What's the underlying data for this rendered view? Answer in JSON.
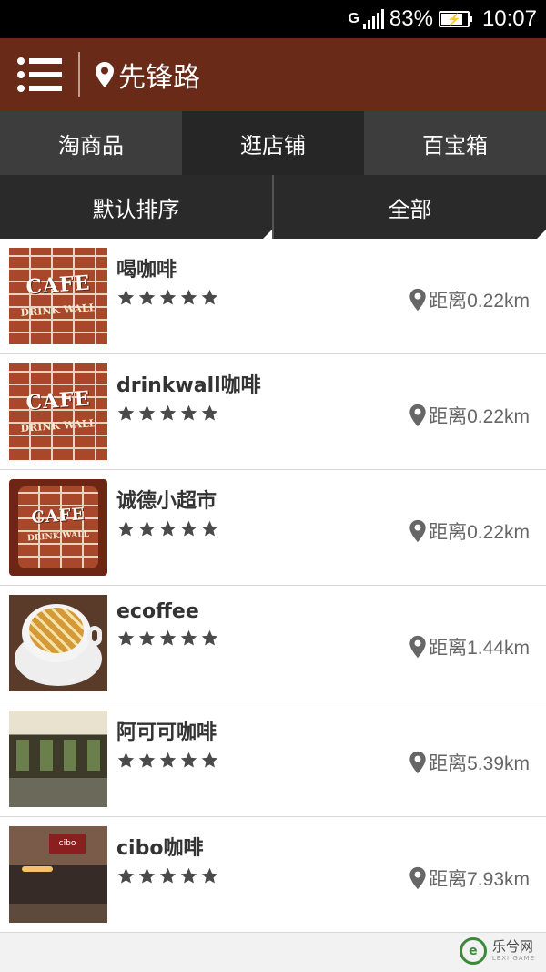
{
  "status_bar": {
    "network": "G",
    "battery": "83%",
    "battery_level": 0.83,
    "time": "10:07"
  },
  "header": {
    "location": "先锋路"
  },
  "tabs": [
    {
      "label": "淘商品"
    },
    {
      "label": "逛店铺"
    },
    {
      "label": "百宝箱"
    }
  ],
  "sort": {
    "order_label": "默认排序",
    "filter_label": "全部"
  },
  "shops": [
    {
      "name": "喝咖啡",
      "rating": 5,
      "distance": "距离0.22km",
      "thumb": "cafe-brick-wall",
      "thumb_title": "CAFE",
      "thumb_subtitle": "DRINK WALL"
    },
    {
      "name": "drinkwall咖啡",
      "rating": 5,
      "distance": "距离0.22km",
      "thumb": "cafe-brick-wall",
      "thumb_title": "CAFE",
      "thumb_subtitle": "DRINK WALL"
    },
    {
      "name": "诚德小超市",
      "rating": 5,
      "distance": "距离0.22km",
      "thumb": "cafe-brick-wall-rounded",
      "thumb_title": "CAFE",
      "thumb_subtitle": "DRINK WALL"
    },
    {
      "name": "ecoffee",
      "rating": 5,
      "distance": "距离1.44km",
      "thumb": "latte-cup"
    },
    {
      "name": "阿可可咖啡",
      "rating": 5,
      "distance": "距离5.39km",
      "thumb": "storefront-photo"
    },
    {
      "name": "cibo咖啡",
      "rating": 5,
      "distance": "距离7.93km",
      "thumb": "cafe-storefront-night",
      "thumb_sign": "cibo"
    }
  ],
  "watermark": {
    "brand": "乐兮网",
    "sub": "LEXI GAME"
  },
  "colors": {
    "header_bg": "#6a2a18",
    "tab_bg": "#2e2e2e",
    "star": "#4a4a4a",
    "distance_text": "#666666"
  }
}
